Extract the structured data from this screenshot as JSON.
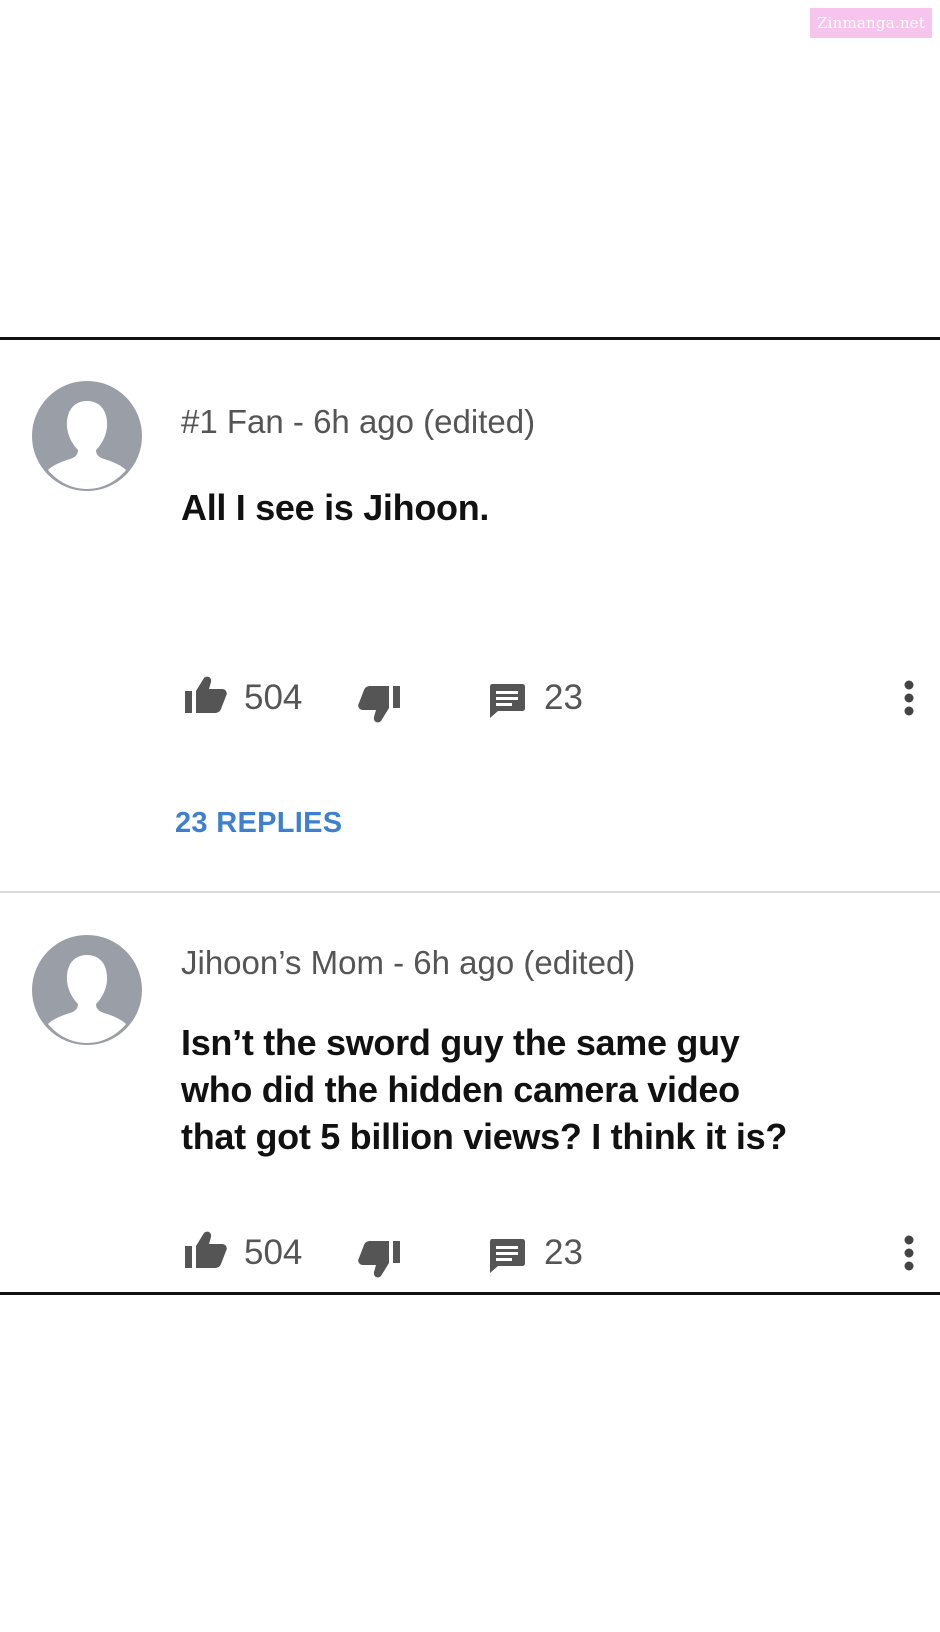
{
  "watermark": "Zinmanga.net",
  "comments": [
    {
      "author_meta": "#1 Fan - 6h ago (edited)",
      "text_lines": [
        "All I see is Jihoon."
      ],
      "likes": "504",
      "replies_count": "23",
      "replies_link": "23 REPLIES"
    },
    {
      "author_meta": "Jihoon’s Mom - 6h ago (edited)",
      "text_lines": [
        "Isn’t the sword guy the same guy",
        "who did the hidden camera video",
        "that got 5 billion views? I think it is?"
      ],
      "likes": "504",
      "replies_count": "23"
    }
  ],
  "icons": {
    "avatar": "user-avatar-icon",
    "like": "thumbs-up-icon",
    "dislike": "thumbs-down-icon",
    "comment": "comment-icon",
    "more": "more-vertical-icon"
  },
  "colors": {
    "link": "#3f7fcf",
    "avatar_bg": "#9a9ea6",
    "meta_text": "#555555"
  }
}
